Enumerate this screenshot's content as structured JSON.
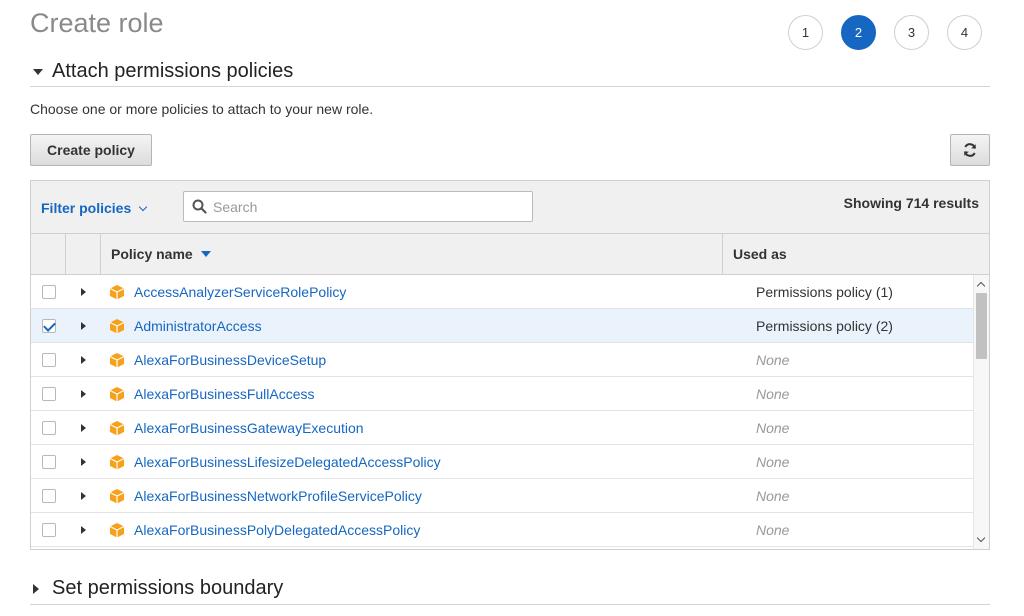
{
  "page": {
    "title": "Create role"
  },
  "steps": [
    {
      "label": "1",
      "active": false
    },
    {
      "label": "2",
      "active": true
    },
    {
      "label": "3",
      "active": false
    },
    {
      "label": "4",
      "active": false
    }
  ],
  "attach_section": {
    "title": "Attach permissions policies",
    "description": "Choose one or more policies to attach to your new role."
  },
  "toolbar": {
    "create_policy_label": "Create policy"
  },
  "filter": {
    "label": "Filter policies",
    "search_placeholder": "Search",
    "results_text": "Showing 714 results"
  },
  "table": {
    "columns": {
      "policy_name": "Policy name",
      "used_as": "Used as"
    },
    "rows": [
      {
        "name": "AccessAnalyzerServiceRolePolicy",
        "used_as": "Permissions policy (1)",
        "checked": false
      },
      {
        "name": "AdministratorAccess",
        "used_as": "Permissions policy (2)",
        "checked": true
      },
      {
        "name": "AlexaForBusinessDeviceSetup",
        "used_as": "None",
        "checked": false
      },
      {
        "name": "AlexaForBusinessFullAccess",
        "used_as": "None",
        "checked": false
      },
      {
        "name": "AlexaForBusinessGatewayExecution",
        "used_as": "None",
        "checked": false
      },
      {
        "name": "AlexaForBusinessLifesizeDelegatedAccessPolicy",
        "used_as": "None",
        "checked": false
      },
      {
        "name": "AlexaForBusinessNetworkProfileServicePolicy",
        "used_as": "None",
        "checked": false
      },
      {
        "name": "AlexaForBusinessPolyDelegatedAccessPolicy",
        "used_as": "None",
        "checked": false
      }
    ]
  },
  "boundary_section": {
    "title": "Set permissions boundary"
  },
  "icons": {
    "collapse": "caret-down-icon",
    "expand": "caret-right-icon",
    "refresh": "refresh-icon",
    "search": "search-icon",
    "policy": "policy-cube-icon",
    "sort": "sort-desc-icon"
  },
  "colors": {
    "accent": "#1667c1",
    "policy_icon": "#f7a01b",
    "selected_row": "#eaf3fc",
    "header_bg": "#f0f0f0"
  }
}
